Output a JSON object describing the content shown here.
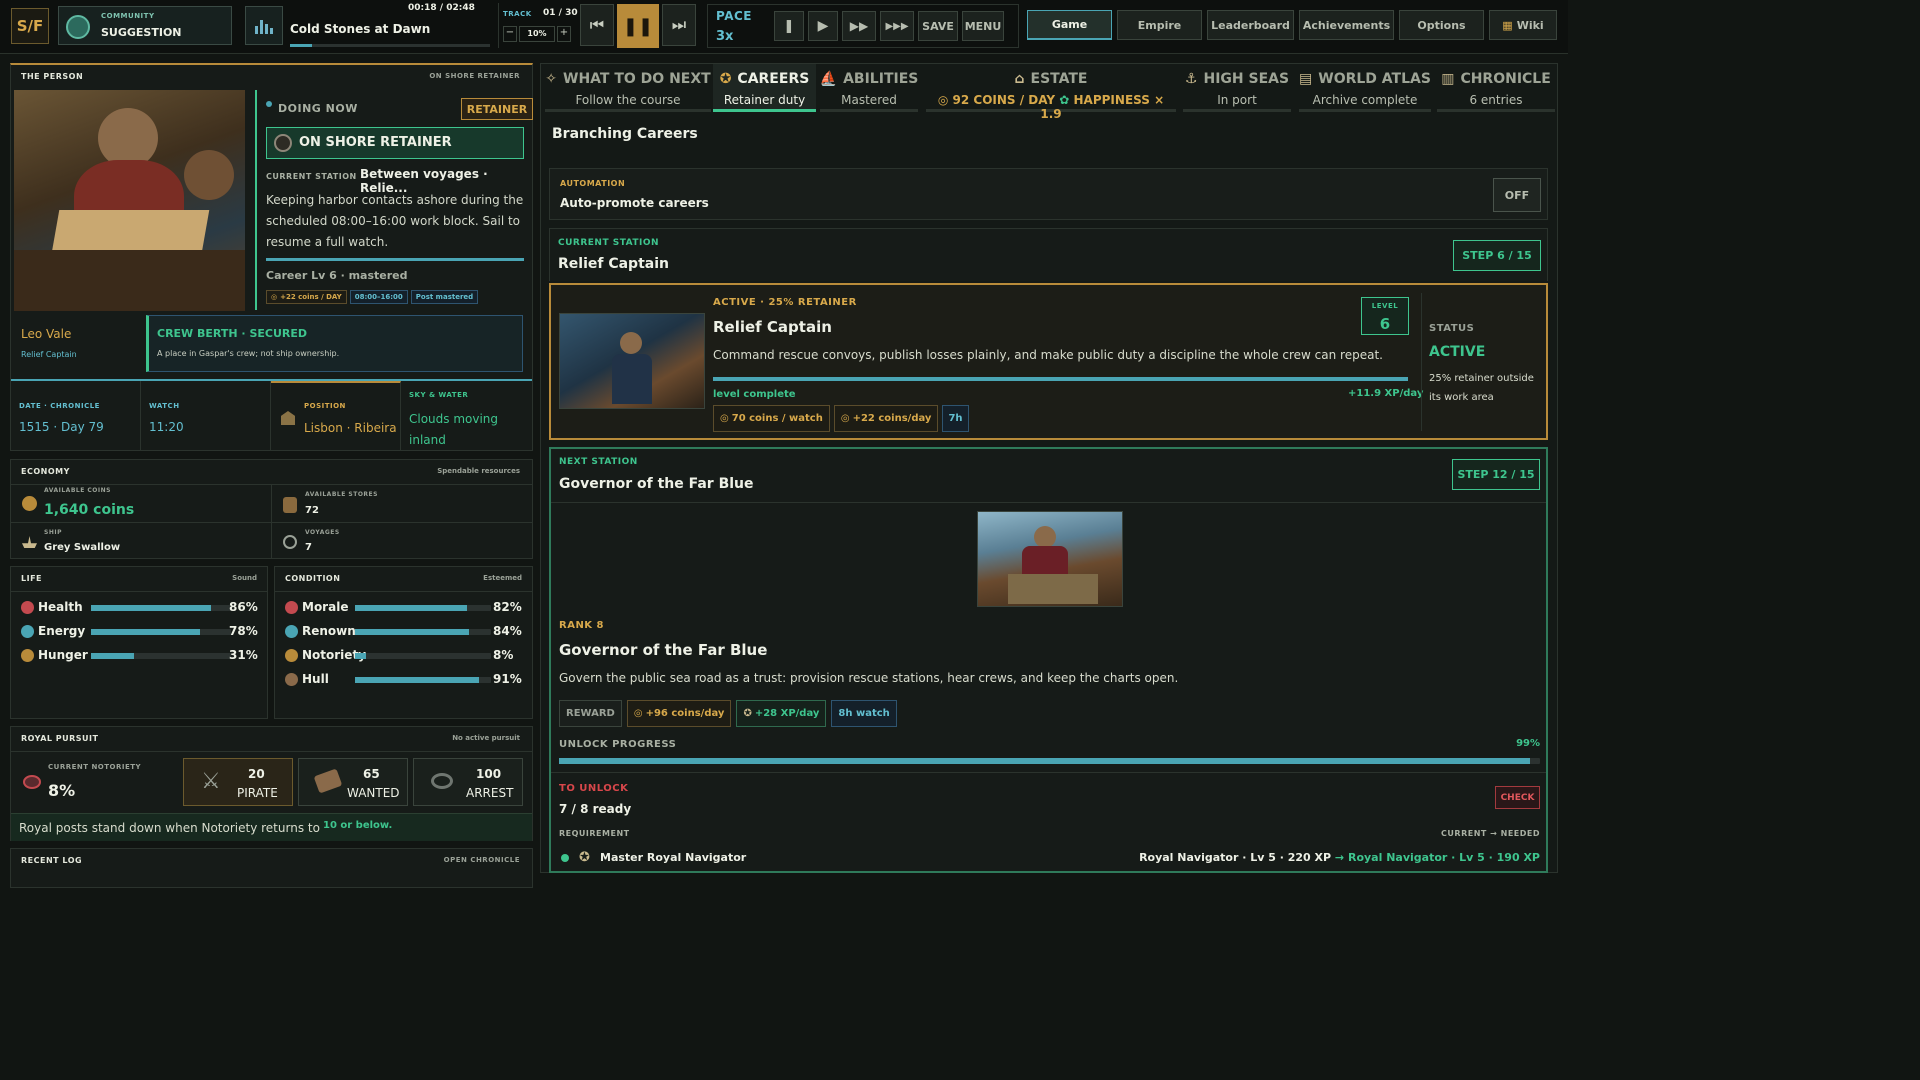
{
  "brand": {
    "logo": "S/F",
    "community_label": "COMMUNITY",
    "community_title": "SUGGESTION"
  },
  "track": {
    "title": "Cold Stones at Dawn",
    "time": "00:18 / 02:48",
    "track_label": "TRACK",
    "track_count": "01 / 30",
    "volume": "10%",
    "progress": 0.11
  },
  "pace": {
    "label": "PACE",
    "value": "3x",
    "save": "SAVE",
    "menu": "MENU"
  },
  "nav": {
    "game": "Game",
    "empire": "Empire",
    "leaderboard": "Leaderboard",
    "achievements": "Achievements",
    "options": "Options",
    "wiki": "Wiki"
  },
  "person": {
    "title": "THE PERSON",
    "tag": "ON SHORE RETAINER",
    "doing_now": "DOING NOW",
    "retainer_badge": "RETAINER",
    "status_title": "ON SHORE RETAINER",
    "station_label": "CURRENT STATION",
    "station_value": "Between voyages · Relie...",
    "desc": "Keeping harbor contacts ashore during the scheduled 08:00–16:00 work block. Sail to resume a full watch.",
    "career_level": "Career Lv 6 · mastered",
    "chip1": "+22 coins / DAY",
    "chip2": "08:00–16:00",
    "chip3": "Post mastered",
    "name": "Leo Vale",
    "role": "Relief Captain",
    "berth_title": "CREW BERTH · SECURED",
    "berth_desc": "A place in Gaspar's crew; not ship ownership."
  },
  "info": {
    "date_label": "DATE · CHRONICLE",
    "date_value": "1515 · Day 79",
    "watch_label": "WATCH",
    "watch_value": "11:20",
    "position_label": "POSITION",
    "position_value": "Lisbon · Ribeira",
    "sky_label": "SKY & WATER",
    "sky_value": "Clouds moving inland"
  },
  "economy": {
    "title": "ECONOMY",
    "tag": "Spendable resources",
    "coins_label": "AVAILABLE COINS",
    "coins_value": "1,640 coins",
    "stores_label": "AVAILABLE STORES",
    "stores_value": "72",
    "ship_label": "SHIP",
    "ship_value": "Grey Swallow",
    "voyages_label": "VOYAGES",
    "voyages_value": "7"
  },
  "life": {
    "title": "LIFE",
    "tag": "Sound",
    "stats": [
      {
        "name": "Health",
        "value": "86%",
        "fill": 0.86
      },
      {
        "name": "Energy",
        "value": "78%",
        "fill": 0.78
      },
      {
        "name": "Hunger",
        "value": "31%",
        "fill": 0.31
      }
    ]
  },
  "condition": {
    "title": "CONDITION",
    "tag": "Esteemed",
    "stats": [
      {
        "name": "Morale",
        "value": "82%",
        "fill": 0.82
      },
      {
        "name": "Renown",
        "value": "84%",
        "fill": 0.84
      },
      {
        "name": "Notoriety",
        "value": "8%",
        "fill": 0.08
      },
      {
        "name": "Hull",
        "value": "91%",
        "fill": 0.91
      }
    ]
  },
  "royal": {
    "title": "ROYAL PURSUIT",
    "tag": "No active pursuit",
    "label": "CURRENT NOTORIETY",
    "value": "8%",
    "t1n": "20",
    "t1l": "PIRATE",
    "t2n": "65",
    "t2l": "WANTED",
    "t3n": "100",
    "t3l": "ARREST",
    "note": "Royal posts stand down when Notoriety returns to",
    "note_strong": "10 or below."
  },
  "log": {
    "title": "RECENT LOG",
    "tag": "OPEN CHRONICLE"
  },
  "tabs": {
    "t1": "WHAT TO DO NEXT",
    "t1s": "Follow the course",
    "t2": "CAREERS",
    "t2s": "Retainer duty",
    "t3": "ABILITIES",
    "t3s": "Mastered",
    "t4": "ESTATE",
    "t4s1": "92 COINS / DAY",
    "t4s2": "HAPPINESS × 1.9",
    "t5": "HIGH SEAS",
    "t5s": "In port",
    "t6": "WORLD ATLAS",
    "t6s": "Archive complete",
    "t7": "CHRONICLE",
    "t7s": "6 entries"
  },
  "careers": {
    "heading": "Branching Careers",
    "auto_label": "AUTOMATION",
    "auto_title": "Auto-promote careers",
    "auto_toggle": "OFF",
    "current_label": "CURRENT STATION",
    "current_title": "Relief Captain",
    "current_step": "STEP 6 / 15",
    "active_label": "ACTIVE · 25% RETAINER",
    "active_title": "Relief Captain",
    "active_desc": "Command rescue convoys, publish losses plainly, and make public duty a discipline the whole crew can repeat.",
    "level_label": "LEVEL",
    "level_value": "6",
    "level_complete": "level complete",
    "xp": "+11.9 XP/day",
    "chip1": "70 coins / watch",
    "chip2": "+22 coins/day",
    "chip3": "7h",
    "status_label": "STATUS",
    "status_value": "ACTIVE",
    "status_desc": "25% retainer outside its work area",
    "next_label": "NEXT STATION",
    "next_title": "Governor of the Far Blue",
    "next_step": "STEP 12 / 15",
    "rank": "RANK 8",
    "rank_title": "Governor of the Far Blue",
    "rank_desc": "Govern the public sea road as a trust: provision rescue stations, hear crews, and keep the charts open.",
    "reward": "REWARD",
    "r1": "+96 coins/day",
    "r2": "+28 XP/day",
    "r3": "8h watch",
    "unlock_label": "UNLOCK PROGRESS",
    "unlock_value": "99%",
    "unlock_fill": 0.99,
    "to_unlock": "TO UNLOCK",
    "ready": "7 / 8 ready",
    "check": "CHECK",
    "req_label": "REQUIREMENT",
    "req_cols": "CURRENT → NEEDED",
    "req_name": "Master Royal Navigator",
    "req_current": "Royal Navigator · Lv 5 · 220 XP",
    "req_arrow": "→",
    "req_needed": "Royal Navigator · Lv 5 · 190 XP"
  }
}
